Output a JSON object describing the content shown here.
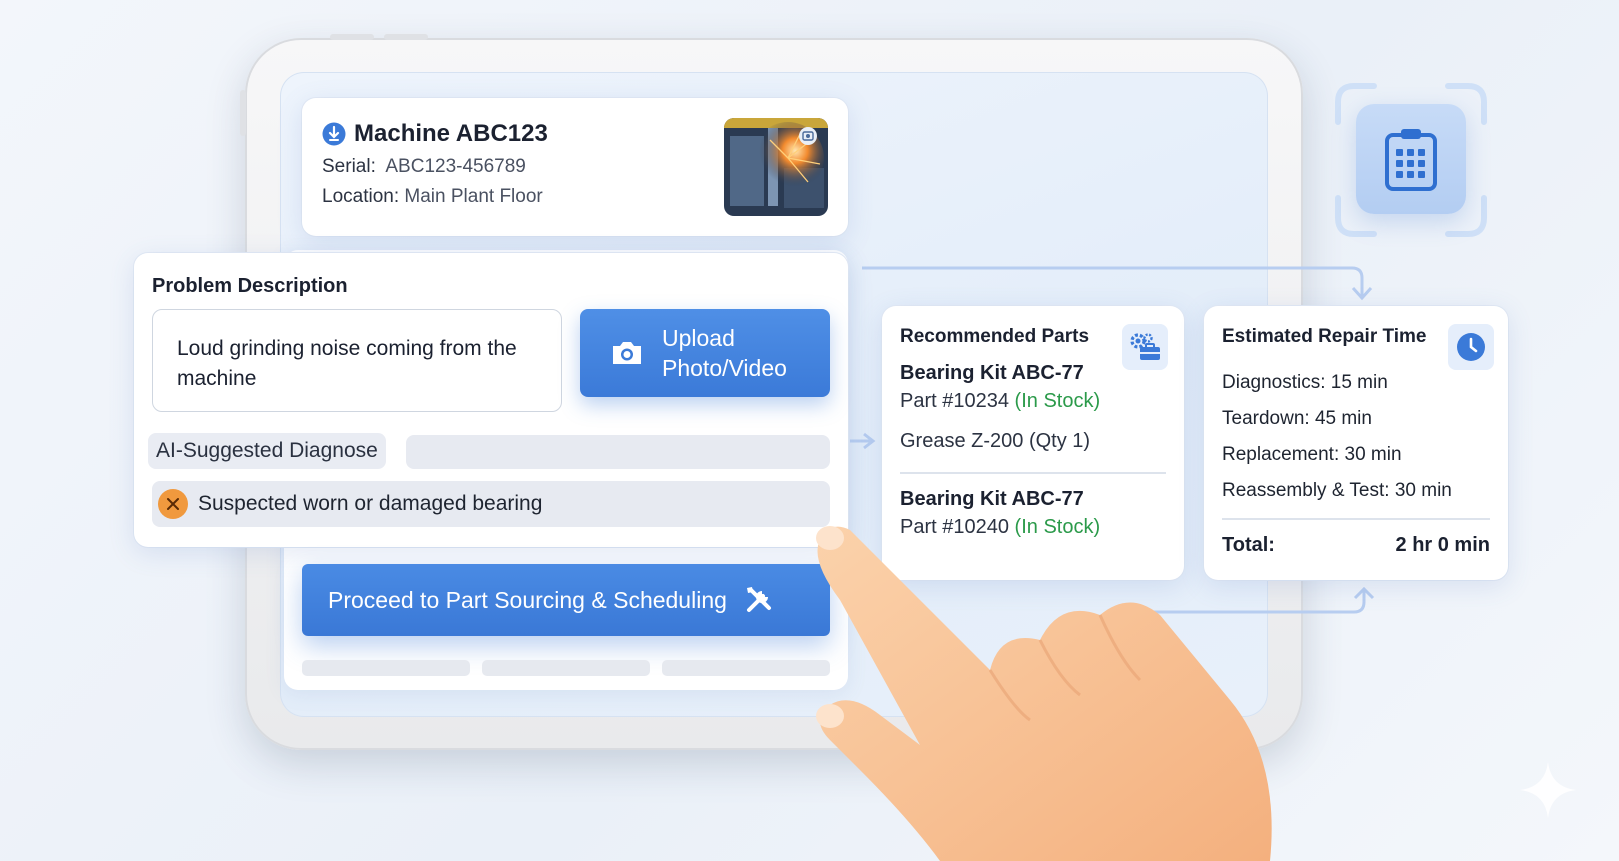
{
  "machine": {
    "title": "Machine ABC123",
    "serial_label": "Serial:",
    "serial_value": "ABC123-456789",
    "location_label": "Location:",
    "location_value": "Main Plant Floor"
  },
  "problem": {
    "label": "Problem Description",
    "text": "Loud grinding noise coming from the machine",
    "upload_label_line1": "Upload",
    "upload_label_line2": "Photo/Video",
    "ai_label": "AI-Suggested Diagnose",
    "diagnosis": "Suspected worn or damaged bearing"
  },
  "proceed_label": "Proceed to Part Sourcing & Scheduling",
  "parts": {
    "title": "Recommended Parts",
    "items": [
      {
        "name": "Bearing Kit ABC-77",
        "number": "Part #10234",
        "stock": "(In Stock)"
      },
      {
        "extra": "Grease Z-200 (Qty 1)"
      },
      {
        "name": "Bearing Kit ABC-77",
        "number": "Part #10240",
        "stock": "(In Stock)"
      }
    ]
  },
  "repair": {
    "title": "Estimated Repair Time",
    "steps": [
      "Diagnostics: 15 min",
      "Teardown: 45 min",
      "Replacement: 30 min",
      "Reassembly & Test: 30 min"
    ],
    "total_label": "Total:",
    "total_value": "2 hr 0 min"
  },
  "colors": {
    "accent": "#3b7ad8",
    "in_stock": "#2b9a4a",
    "warning": "#f0993e"
  },
  "icons": {
    "machine": "pin-icon",
    "upload": "camera-icon",
    "diagnosis": "close-circle-icon",
    "proceed": "tools-icon",
    "parts": "gears-toolbox-icon",
    "repair": "clock-icon",
    "tile": "clipboard-icon"
  }
}
